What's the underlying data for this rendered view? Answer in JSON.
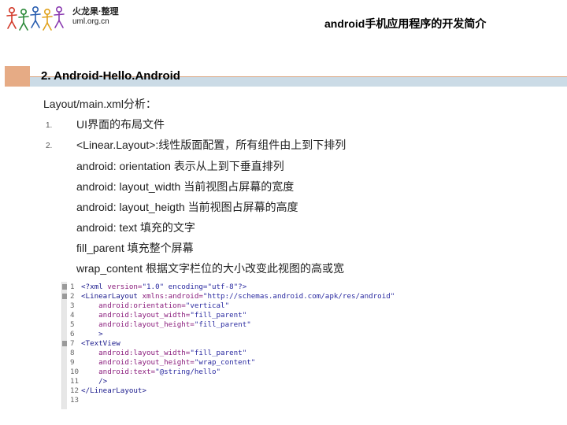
{
  "header": {
    "logo_name": "火龙果·整理",
    "logo_url": "uml.org.cn",
    "title": "android手机应用程序的开发简介"
  },
  "section": {
    "heading": "2. Android-Hello.Android",
    "subheading": "Layout/main.xml分析："
  },
  "items": [
    {
      "number": "1.",
      "text": "UI界面的布局文件"
    },
    {
      "number": "2.",
      "text": "<Linear.Layout>:线性版面配置，所有组件由上到下排列"
    }
  ],
  "details": [
    "android: orientation  表示从上到下垂直排列",
    "android: layout_width  当前视图占屏幕的宽度",
    "android: layout_heigth  当前视图占屏幕的高度",
    "android: text  填充的文字",
    "fill_parent  填充整个屏幕",
    "wrap_content  根据文字栏位的大小改变此视图的高或宽"
  ],
  "code": [
    {
      "n": "1",
      "tag": "<?xml ",
      "attr": "version=",
      "val": "\"1.0\" encoding=\"utf-8\"?>"
    },
    {
      "n": "2",
      "tag": "<LinearLayout ",
      "attr": "xmlns:android=",
      "val": "\"http://schemas.android.com/apk/res/android\""
    },
    {
      "n": "3",
      "tag": "    ",
      "attr": "android:orientation=",
      "val": "\"vertical\""
    },
    {
      "n": "4",
      "tag": "    ",
      "attr": "android:layout_width=",
      "val": "\"fill_parent\""
    },
    {
      "n": "5",
      "tag": "    ",
      "attr": "android:layout_height=",
      "val": "\"fill_parent\""
    },
    {
      "n": "6",
      "tag": "    >",
      "attr": "",
      "val": ""
    },
    {
      "n": "7",
      "tag": "<TextView",
      "attr": "",
      "val": ""
    },
    {
      "n": "8",
      "tag": "    ",
      "attr": "android:layout_width=",
      "val": "\"fill_parent\""
    },
    {
      "n": "9",
      "tag": "    ",
      "attr": "android:layout_height=",
      "val": "\"wrap_content\""
    },
    {
      "n": "10",
      "tag": "    ",
      "attr": "android:text=",
      "val": "\"@string/hello\""
    },
    {
      "n": "11",
      "tag": "    />",
      "attr": "",
      "val": ""
    },
    {
      "n": "12",
      "tag": "</LinearLayout>",
      "attr": "",
      "val": ""
    },
    {
      "n": "13",
      "tag": "",
      "attr": "",
      "val": ""
    }
  ]
}
